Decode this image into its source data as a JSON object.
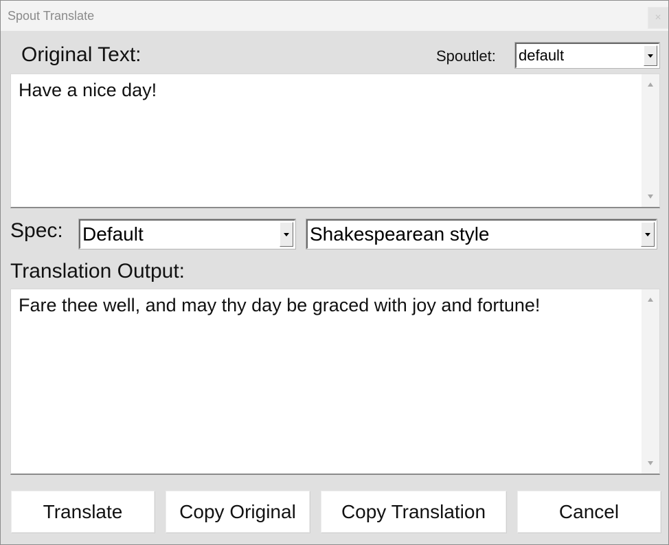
{
  "window": {
    "title": "Spout Translate",
    "close_glyph": "×"
  },
  "original": {
    "label": "Original Text:",
    "text": "Have a nice day!"
  },
  "spoutlet": {
    "label": "Spoutlet:",
    "selected": "default"
  },
  "spec": {
    "label": "Spec:",
    "selected": "Default",
    "style_selected": "Shakespearean style"
  },
  "output": {
    "label": "Translation Output:",
    "text": "Fare thee well, and may thy day be graced with joy and fortune!"
  },
  "buttons": {
    "translate": "Translate",
    "copy_original": "Copy Original",
    "copy_translation": "Copy Translation",
    "cancel": "Cancel"
  },
  "icons": {
    "close": "close-icon",
    "dropdown": "chevron-down-icon",
    "scroll_up": "scroll-up-icon",
    "scroll_down": "scroll-down-icon"
  }
}
